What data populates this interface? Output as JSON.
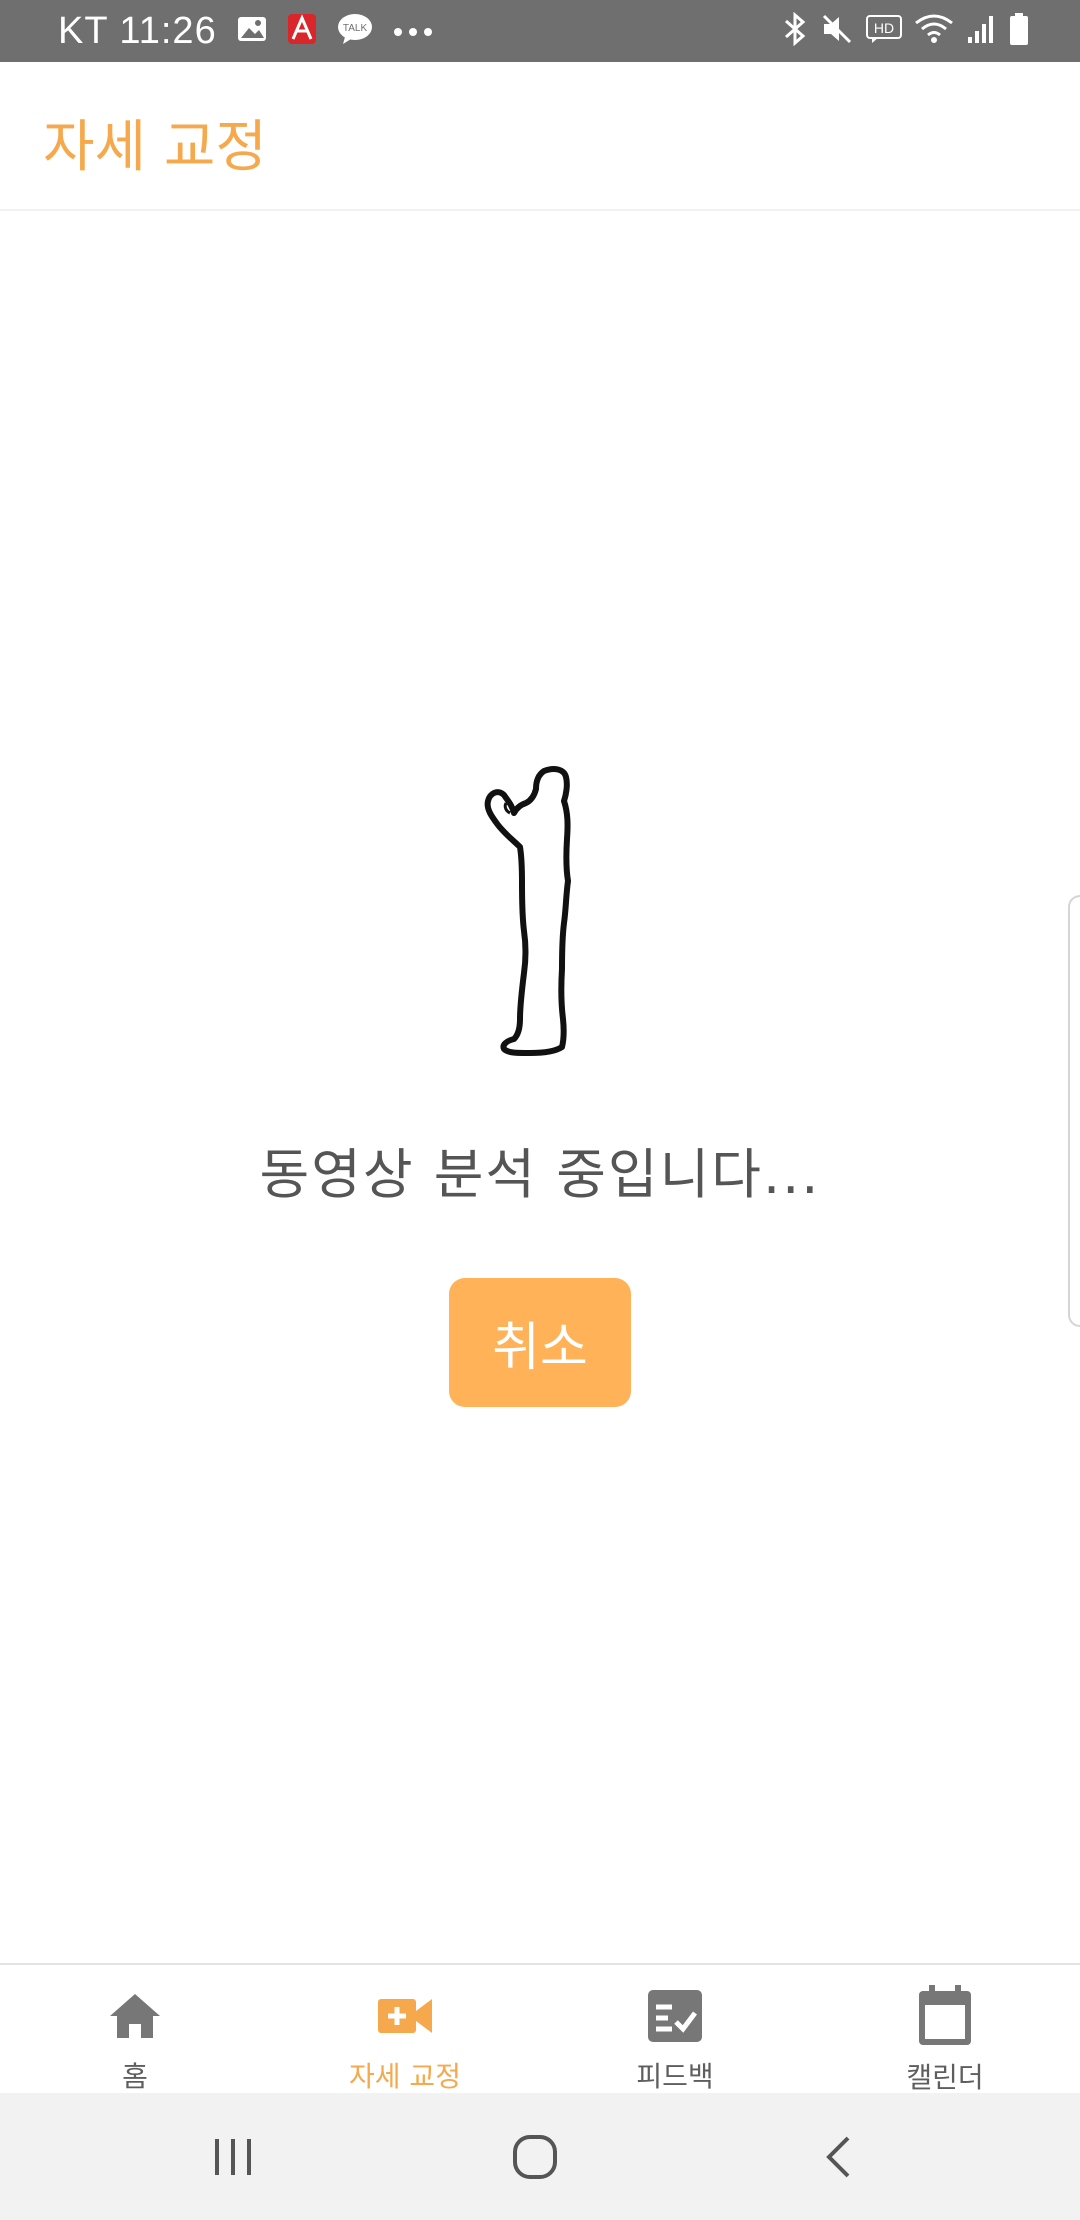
{
  "status_bar": {
    "carrier_time": "KT 11:26",
    "left_icons": [
      "image-icon",
      "acrobat-icon",
      "kakaotalk-icon",
      "more-dots-icon"
    ],
    "right_icons": [
      "bluetooth-icon",
      "mute-icon",
      "hd-icon",
      "wifi-icon",
      "signal-icon",
      "battery-icon"
    ]
  },
  "app_bar": {
    "title": "자세 교정"
  },
  "content": {
    "illustration": "person-silhouette-icon",
    "message": "동영상 분석 중입니다...",
    "cancel_label": "취소"
  },
  "bottom_nav": {
    "items": [
      {
        "label": "홈",
        "icon": "home-icon"
      },
      {
        "label": "자세 교정",
        "icon": "video-add-icon"
      },
      {
        "label": "피드백",
        "icon": "checklist-icon"
      },
      {
        "label": "캘린더",
        "icon": "calendar-icon"
      }
    ],
    "active_index": 1
  },
  "system_nav": {
    "buttons": [
      "recent-apps-icon",
      "home-circle-icon",
      "back-icon"
    ]
  },
  "colors": {
    "accent": "#f5a94c",
    "button": "#ffb257",
    "status_bar": "#6f6f6f",
    "text": "#555555"
  }
}
